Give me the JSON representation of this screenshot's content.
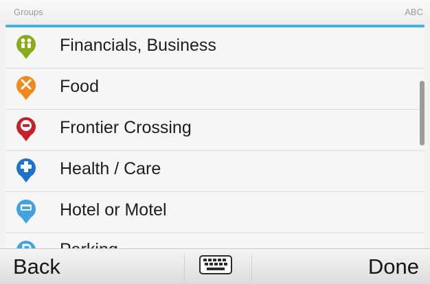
{
  "header": {
    "title": "Groups",
    "mode": "ABC"
  },
  "list": {
    "items": [
      {
        "label": "Financials, Business",
        "icon": "financials-business-icon",
        "color": "#8aaa1a"
      },
      {
        "label": "Food",
        "icon": "food-icon",
        "color": "#f08a1c"
      },
      {
        "label": "Frontier Crossing",
        "icon": "frontier-crossing-icon",
        "color": "#c8202a"
      },
      {
        "label": "Health / Care",
        "icon": "health-care-icon",
        "color": "#1f72c9"
      },
      {
        "label": "Hotel or Motel",
        "icon": "hotel-motel-icon",
        "color": "#43a3e0"
      },
      {
        "label": "Parking",
        "icon": "parking-icon",
        "color": "#43a3e0"
      }
    ]
  },
  "footer": {
    "back_label": "Back",
    "keyboard_icon": "keyboard-icon",
    "done_label": "Done"
  },
  "colors": {
    "accent_line": "#47b3d9",
    "scrollbar": "#9c9c9c"
  }
}
